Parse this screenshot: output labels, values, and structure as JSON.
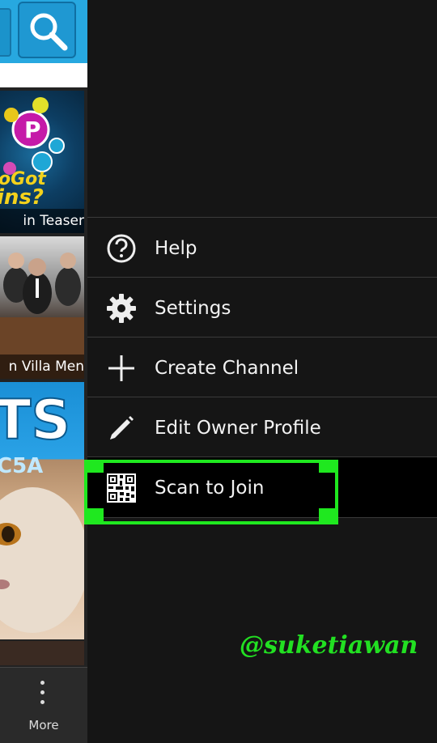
{
  "background_app": {
    "tiles": [
      {
        "caption": "in Teaser"
      },
      {
        "caption": "n Villa Men"
      },
      {
        "caption": ""
      }
    ],
    "tile1_art_text": "oGot\nins?",
    "tile3_art_text": "TS\nC5A",
    "bottom_bar": {
      "more_label": "More"
    }
  },
  "drawer": {
    "menu": [
      {
        "label": "Help",
        "icon": "help-circle-icon"
      },
      {
        "label": "Settings",
        "icon": "gear-icon"
      },
      {
        "label": "Create Channel",
        "icon": "plus-icon"
      },
      {
        "label": "Edit Owner Profile",
        "icon": "pencil-icon"
      },
      {
        "label": "Scan to Join",
        "icon": "qr-code-icon",
        "highlighted": true
      }
    ]
  },
  "watermark": "@suketiawan",
  "colors": {
    "highlight": "#1fe81f",
    "topbar": "#27a8e0",
    "drawer_bg": "#151515"
  }
}
